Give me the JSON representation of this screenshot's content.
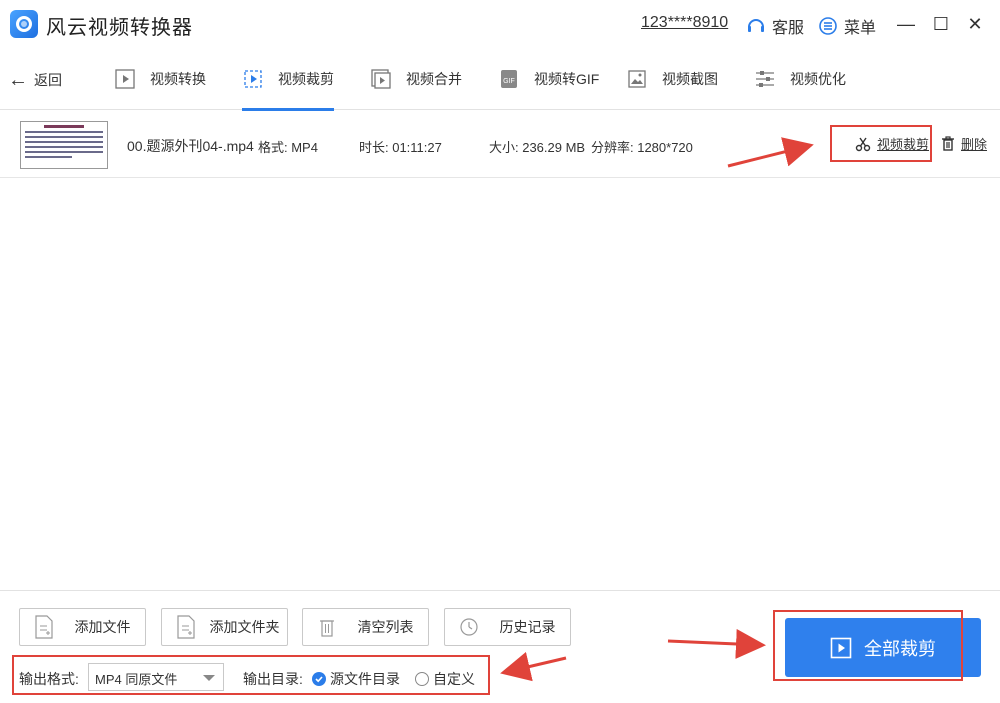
{
  "app": {
    "title": "风云视频转换器",
    "account": "123****8910"
  },
  "titlebar": {
    "service_label": "客服",
    "menu_label": "菜单",
    "minimize_glyph": "—",
    "maximize_glyph": "☐",
    "close_glyph": "✕"
  },
  "nav": {
    "back_label": "返回",
    "tabs": [
      {
        "label": "视频转换",
        "icon": "video-play-icon"
      },
      {
        "label": "视频裁剪",
        "icon": "video-crop-icon",
        "active": true
      },
      {
        "label": "视频合并",
        "icon": "video-merge-icon"
      },
      {
        "label": "视频转GIF",
        "icon": "gif-icon"
      },
      {
        "label": "视频截图",
        "icon": "screenshot-icon"
      },
      {
        "label": "视频优化",
        "icon": "sliders-icon"
      }
    ]
  },
  "file": {
    "name": "00.题源外刊04-.mp4",
    "format": "格式: MP4",
    "duration": "时长: 01:11:27",
    "size": "大小: 236.29 MB",
    "resolution": "分辨率: 1280*720",
    "crop_action": "视频裁剪",
    "delete_action": "删除"
  },
  "bottom": {
    "add_file": "添加文件",
    "add_folder": "添加文件夹",
    "clear_list": "清空列表",
    "history": "历史记录",
    "output_format_label": "输出格式:",
    "output_format_value": "MP4 同原文件",
    "output_dir_label": "输出目录:",
    "dir_source": "源文件目录",
    "dir_custom": "自定义",
    "dir_selected": "源文件目录",
    "primary_button": "全部裁剪"
  },
  "colors": {
    "accent": "#2f80ed",
    "annotation": "#e0433a"
  }
}
